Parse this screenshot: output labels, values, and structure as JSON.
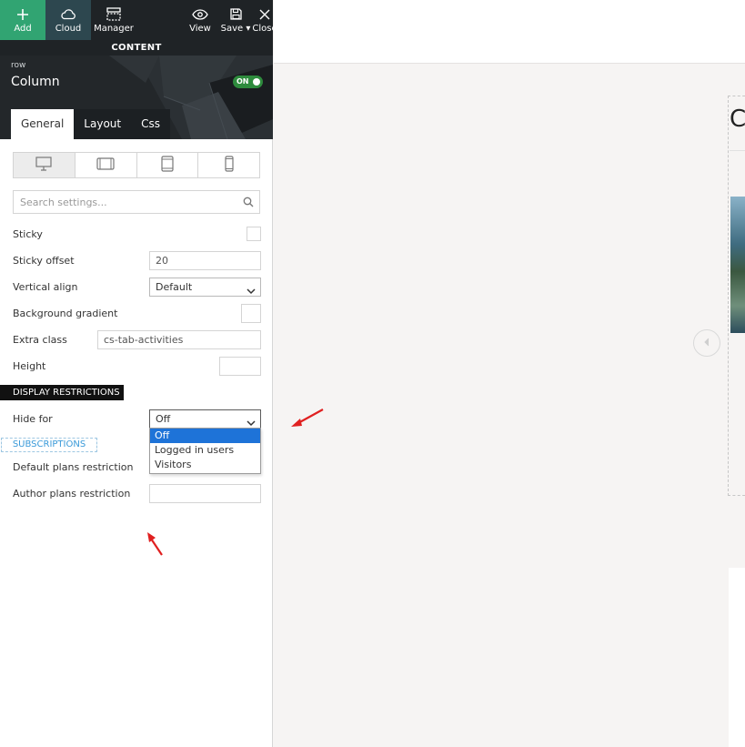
{
  "toolbar": {
    "add": "Add",
    "cloud": "Cloud",
    "manager": "Manager",
    "view": "View",
    "save": "Save",
    "close": "Close"
  },
  "content_bar": "CONTENT",
  "element": {
    "type": "row",
    "title": "Column",
    "toggle": "ON"
  },
  "tabs": [
    "General",
    "Layout",
    "Css"
  ],
  "devices": [
    "desktop-icon",
    "tablet-landscape-icon",
    "tablet-portrait-icon",
    "mobile-icon"
  ],
  "search": {
    "placeholder": "Search settings..."
  },
  "settings": {
    "sticky_label": "Sticky",
    "sticky_offset_label": "Sticky offset",
    "sticky_offset_value": "20",
    "vertical_align_label": "Vertical align",
    "vertical_align_value": "Default",
    "background_gradient_label": "Background gradient",
    "extra_class_label": "Extra class",
    "extra_class_value": "cs-tab-activities",
    "height_label": "Height"
  },
  "display_restrictions": {
    "section_title": "DISPLAY RESTRICTIONS",
    "hide_for_label": "Hide for",
    "hide_for_value": "Off",
    "options": [
      "Off",
      "Logged in users",
      "Visitors"
    ]
  },
  "subscriptions": {
    "section_title": "SUBSCRIPTIONS",
    "default_plans_label": "Default plans restriction",
    "author_plans_label": "Author plans restriction"
  },
  "colors": {
    "add_button": "#31a472",
    "cloud_button": "#2d474f",
    "toolbar_bg": "#1f2326",
    "toggle_on": "#2e8b3d",
    "dropdown_selected": "#1e73d8",
    "annotation_arrow": "#e02020",
    "subscriptions_accent": "#3a9ad9"
  },
  "preview": {
    "heading_fragment": "C"
  }
}
